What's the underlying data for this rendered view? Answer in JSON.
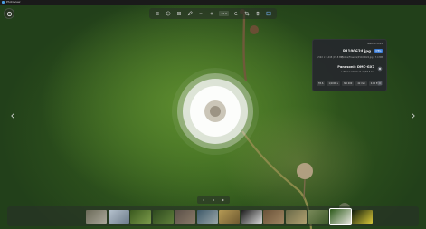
{
  "window": {
    "title": "Photoview"
  },
  "toolbar": {
    "zoom_value": "13.9",
    "buttons": [
      "list-icon",
      "info-icon",
      "grid-icon",
      "edit-icon",
      "zoom-out-icon",
      "zoom-in-icon",
      "rotate-icon",
      "crop-icon",
      "delete-icon",
      "fullscreen-icon"
    ]
  },
  "info": {
    "date": "Natural 2024",
    "filename": "P1100624.jpg",
    "badge": "JPEG",
    "dimensions": "4,592 × 3,448 (15.8 MP)",
    "path": "Photos/Flowers/P1100624.jpg · 7.4 MB",
    "camera": "Panasonic DMC-GX7",
    "lens": "LUMIX G VARIO 14-42/F3.5-5.6",
    "exif": [
      "f/5.6",
      "1/1000 s",
      "ISO 200",
      "42 mm",
      "0.00 EV"
    ]
  },
  "filmstrip": {
    "thumb_colors": [
      [
        "#6b6a58",
        "#aaa79a"
      ],
      [
        "#b7c3cf",
        "#6c7b8a"
      ],
      [
        "#3b5a1f",
        "#7b9a4a"
      ],
      [
        "#2e4a1f",
        "#5f7f3a"
      ],
      [
        "#5a5048",
        "#8a7a68"
      ],
      [
        "#3e5a6a",
        "#9aa6a8"
      ],
      [
        "#b59a55",
        "#6f5a30"
      ],
      [
        "#1e1e1e",
        "#d8d8d8"
      ],
      [
        "#6a5238",
        "#a08562"
      ],
      [
        "#6a6a48",
        "#b0a070"
      ],
      [
        "#7a8a5a",
        "#3f5a2a"
      ],
      [
        "#2d5a1a",
        "#e8e8e0"
      ],
      [
        "#0e1a0a",
        "#d8c83a"
      ]
    ],
    "active_index": 11
  }
}
